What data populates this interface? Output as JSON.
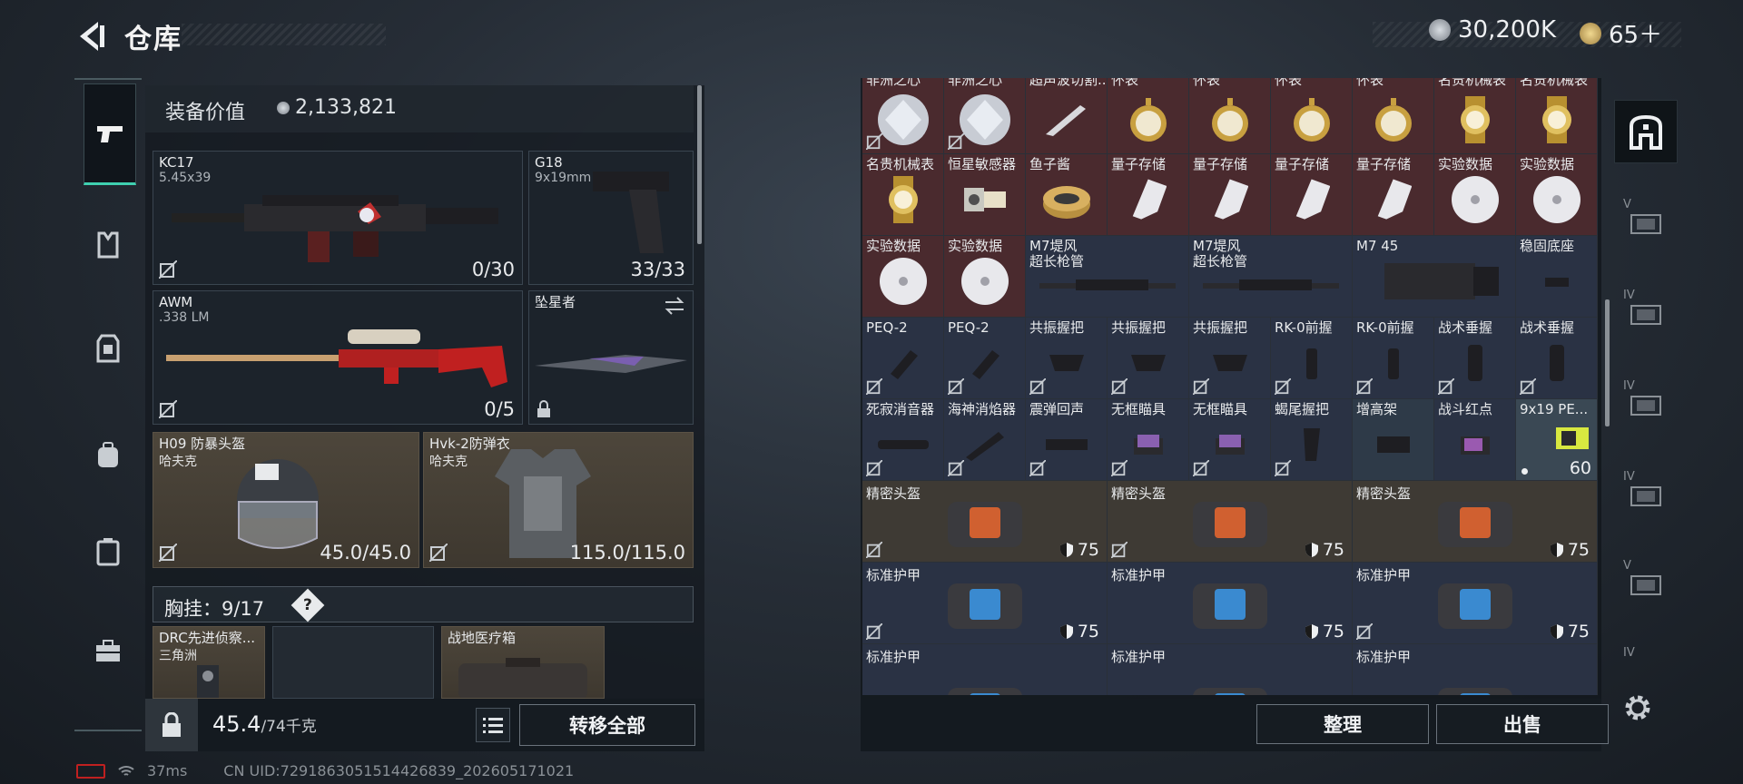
{
  "header": {
    "title": "仓库",
    "currency1": "30,200K",
    "currency2": "65＋"
  },
  "equipment": {
    "value_label": "装备价值",
    "value": "2,133,821",
    "primary1": {
      "name": "KC17",
      "caliber": "5.45x39",
      "ammo": "0/30"
    },
    "sidearm": {
      "name": "G18",
      "caliber": "9x19mm",
      "ammo": "33/33"
    },
    "primary2": {
      "name": "AWM",
      "caliber": ".338 LM",
      "ammo": "0/5"
    },
    "melee": {
      "name": "坠星者"
    },
    "helmet": {
      "name": "H09 防暴头盔",
      "brand": "哈夫克",
      "durability": "45.0/45.0"
    },
    "armor": {
      "name": "Hvk-2防弹衣",
      "brand": "哈夫克",
      "durability": "115.0/115.0"
    },
    "chest_rig": {
      "label": "胸挂：9/17",
      "help": "?"
    },
    "backpack1": {
      "name": "DRC先进侦察...",
      "brand": "三角洲"
    },
    "medkit": {
      "name": "战地医疗箱"
    }
  },
  "footer_left": {
    "weight_value": "45.4",
    "weight_max": "/74千克",
    "transfer_all": "转移全部"
  },
  "footer_right": {
    "sort": "整理",
    "sell": "出售"
  },
  "status": {
    "ping": "37ms",
    "uid": "CN UID:7291863051514426839_202605171021"
  },
  "grid": {
    "row0": [
      "非洲之心",
      "非洲之心",
      "超声波切割...",
      "怀表",
      "怀表",
      "怀表",
      "怀表",
      "名贵机械表",
      "名贵机械表"
    ],
    "row1": [
      "名贵机械表",
      "恒星敏感器",
      "鱼子酱",
      "量子存储",
      "量子存储",
      "量子存储",
      "量子存储",
      "实验数据",
      "实验数据"
    ],
    "row2_small": [
      "实验数据",
      "实验数据"
    ],
    "row2_m7a": "M7堤风\n超长枪管",
    "row2_m7b": "M7堤风\n超长枪管",
    "row2_m745": "M7 45",
    "row2_stable": "稳固底座",
    "row3": [
      "PEQ-2",
      "PEQ-2",
      "共振握把",
      "共振握把",
      "共振握把",
      "RK-0前握",
      "RK-0前握",
      "战术垂握",
      "战术垂握"
    ],
    "row4": [
      "死寂消音器",
      "海神消焰器",
      "震弹回声",
      "无框瞄具",
      "无框瞄具",
      "蝎尾握把",
      "增高架",
      "战斗红点",
      "9x19 PE..."
    ],
    "ammo_qty": "60",
    "helmets": [
      "精密头盔",
      "精密头盔",
      "精密头盔"
    ],
    "armors1": [
      "标准护甲",
      "标准护甲",
      "标准护甲"
    ],
    "armors2": [
      "标准护甲",
      "标准护甲",
      "标准护甲"
    ],
    "armor_value": "75"
  },
  "warehouse_tabs": [
    "V",
    "IV",
    "IV",
    "IV",
    "V",
    "IV"
  ],
  "colors": {
    "accent": "#3fd0b0",
    "red_cell": "#4a2a2e",
    "blue_cell": "#2a3244",
    "tan_cell": "#3e3a34"
  }
}
